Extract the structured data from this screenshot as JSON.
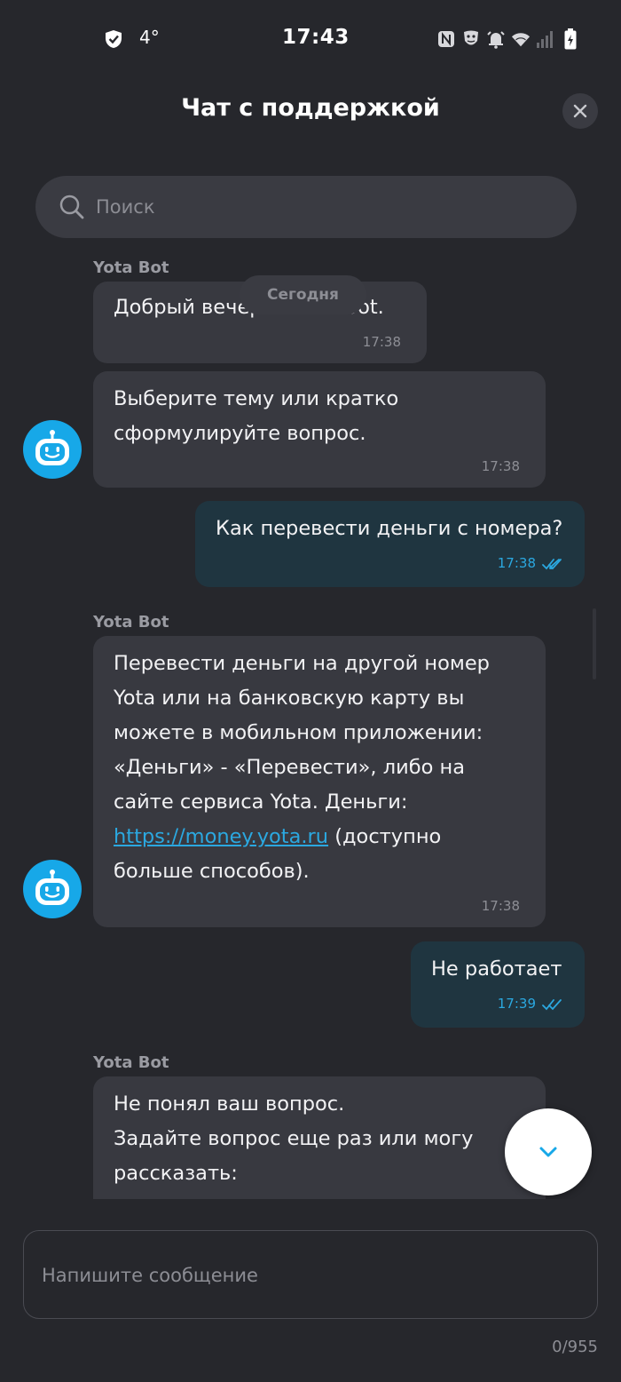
{
  "status_bar": {
    "temperature": "4°",
    "time": "17:43"
  },
  "header": {
    "title": "Чат с поддержкой"
  },
  "search": {
    "placeholder": "Поиск"
  },
  "chat": {
    "date_separator": "Сегодня",
    "messages": [
      {
        "sender": "Yota Bot",
        "text": "Добрый вечер! Я Yota bot.",
        "time": "17:38"
      },
      {
        "text": "Выберите тему или кратко\nсформулируйте вопрос.",
        "time": "17:38"
      },
      {
        "text": "Как перевести деньги с номера?",
        "time": "17:38"
      },
      {
        "sender": "Yota Bot",
        "text_before_link": "Перевести деньги на другой номер\nYota или на банковскую карту вы\nможете в мобильном приложении:\n«Деньги» - «Перевести», либо на\nсайте сервиса Yota. Деньги:\n",
        "link": "https://money.yota.ru",
        "text_after_link": " (доступно\nбольше способов).",
        "time": "17:38"
      },
      {
        "text": "Не работает",
        "time": "17:39"
      },
      {
        "sender": "Yota Bot",
        "text": "Не понял ваш вопрос.\nЗадайте вопрос еще раз или могу\nрассказать:"
      }
    ]
  },
  "composer": {
    "placeholder": "Напишите сообщение",
    "counter": "0/955"
  },
  "colors": {
    "background": "#26272c",
    "bot_bubble": "#383940",
    "user_bubble": "#1f3540",
    "accent": "#2ba8e0",
    "avatar": "#17a8e8"
  },
  "icons": {
    "close": "close-icon",
    "search": "search-icon",
    "scroll_down": "chevron-down-icon",
    "read_receipt": "double-check-icon",
    "bot_avatar": "robot-icon"
  }
}
